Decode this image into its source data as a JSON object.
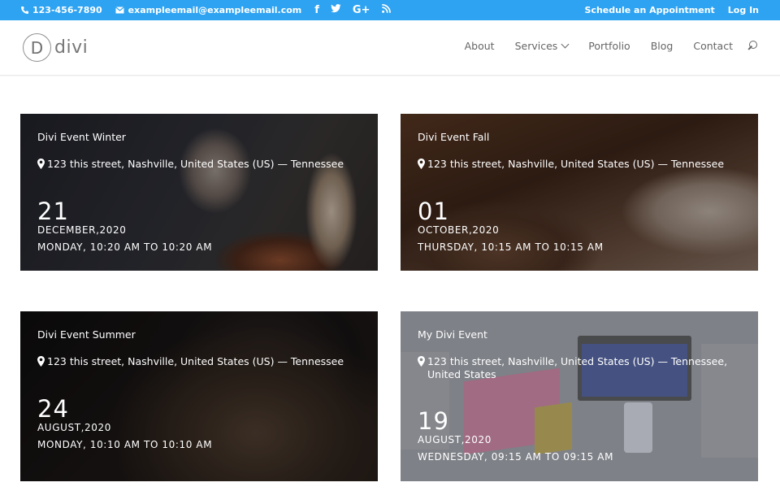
{
  "topbar": {
    "phone": "123-456-7890",
    "email": "exampleemail@exampleemail.com",
    "social": [
      "f",
      "t",
      "G+",
      "rss"
    ],
    "appointment": "Schedule an Appointment",
    "login": "Log In"
  },
  "header": {
    "logo_mark": "D",
    "logo_text": "divi",
    "nav": {
      "about": "About",
      "services": "Services",
      "portfolio": "Portfolio",
      "blog": "Blog",
      "contact": "Contact"
    }
  },
  "events": [
    {
      "title": "Divi Event Winter",
      "address": "123 this street, Nashville, United States (US) — Tennessee",
      "day": "21",
      "month_year": "DECEMBER,2020",
      "time": "MONDAY, 10:20 AM TO 10:20 AM"
    },
    {
      "title": "Divi Event Fall",
      "address": "123 this street, Nashville, United States (US) — Tennessee",
      "day": "01",
      "month_year": "OCTOBER,2020",
      "time": "THURSDAY, 10:15 AM TO 10:15 AM"
    },
    {
      "title": "Divi Event Summer",
      "address": "123 this street, Nashville, United States (US) — Tennessee",
      "day": "24",
      "month_year": "AUGUST,2020",
      "time": "MONDAY, 10:10 AM TO 10:10 AM"
    },
    {
      "title": "My Divi Event",
      "address": "123 this street, Nashville, United States (US) — Tennessee, United States",
      "day": "19",
      "month_year": "AUGUST,2020",
      "time": "WEDNESDAY, 09:15 AM TO 09:15 AM"
    }
  ],
  "colors": {
    "topbar": "#2ea3f2",
    "nav_text": "#666666"
  }
}
